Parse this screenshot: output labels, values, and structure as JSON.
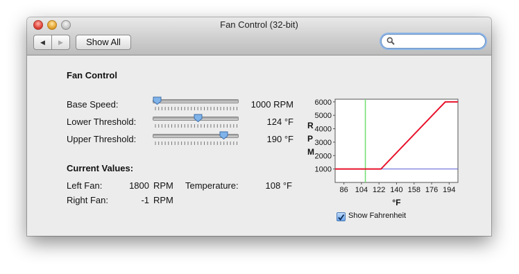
{
  "window": {
    "title": "Fan Control (32-bit)"
  },
  "toolbar": {
    "back_label": "◀",
    "forward_label": "▶",
    "show_all_label": "Show All",
    "search": {
      "value": "",
      "placeholder": ""
    }
  },
  "section_title": "Fan Control",
  "controls": [
    {
      "label": "Base Speed:",
      "value": "1000 RPM",
      "position": 0.0
    },
    {
      "label": "Lower Threshold:",
      "value": "124 °F",
      "position": 0.54
    },
    {
      "label": "Upper Threshold:",
      "value": "190 °F",
      "position": 0.87
    }
  ],
  "current_values": {
    "title": "Current Values:",
    "left_fan_label": "Left Fan:",
    "left_fan_value": "1800",
    "left_fan_unit": "RPM",
    "right_fan_label": "Right Fan:",
    "right_fan_value": "-1",
    "right_fan_unit": "RPM",
    "temperature_label": "Temperature:",
    "temperature_value": "108 °F"
  },
  "chart_data": {
    "type": "line",
    "ylabel": "RPM",
    "xlabel": "°F",
    "y_ticks": [
      "6000",
      "5000",
      "4000",
      "3000",
      "2000",
      "1000"
    ],
    "x_ticks": [
      "86",
      "104",
      "122",
      "140",
      "158",
      "176",
      "194"
    ],
    "ylim": [
      0,
      6200
    ],
    "xlim": [
      77,
      203
    ],
    "series": [
      {
        "x": [
          77,
          124,
          190,
          203
        ],
        "y": [
          1000,
          1000,
          6000,
          6000
        ],
        "color": "#e8102a"
      }
    ],
    "current_temperature_marker": {
      "x": 108,
      "color": "#6fe06f"
    },
    "base_speed_line": {
      "y": 1000,
      "color": "#5a5ad0"
    }
  },
  "show_fahrenheit": {
    "label": "Show Fahrenheit",
    "checked": true
  }
}
